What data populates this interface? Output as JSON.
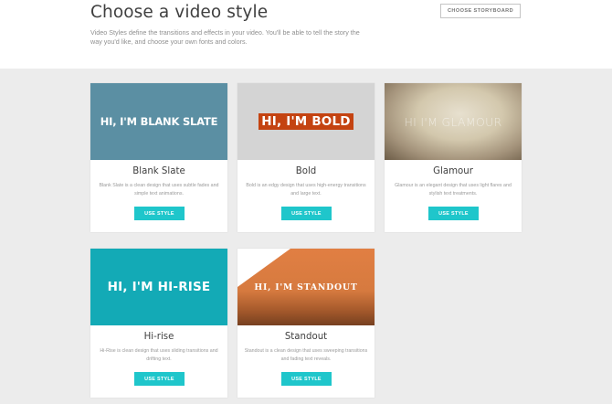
{
  "header": {
    "title": "Choose a video style",
    "subtitle": "Video Styles define the transitions and effects in your video. You'll be able to tell the story the way you'd like, and choose your own fonts and colors.",
    "storyboard_button": "CHOOSE STORYBOARD"
  },
  "styles": [
    {
      "name": "Blank Slate",
      "thumb_text": "HI, I'M BLANK SLATE",
      "description": "Blank Slate is a clean design that uses subtle fades and simple text animations.",
      "button": "USE STYLE",
      "color": "#5b8fa3"
    },
    {
      "name": "Bold",
      "thumb_text": "HI, I'M BOLD",
      "description": "Bold is an edgy design that uses high-energy transitions and large text.",
      "button": "USE STYLE",
      "color": "#c44311"
    },
    {
      "name": "Glamour",
      "thumb_text": "HI I'M GLAMOUR",
      "description": "Glamour is an elegant design that uses light flares and stylish text treatments.",
      "button": "USE STYLE",
      "color": "#d3c8ad"
    },
    {
      "name": "Hi-rise",
      "thumb_text": "HI, I'M HI-RISE",
      "description": "Hi-Rise is clean design that uses sliding transitions and drifting text.",
      "button": "USE STYLE",
      "color": "#13aab6"
    },
    {
      "name": "Standout",
      "thumb_text": "HI, I'M STANDOUT",
      "description": "Standout is a clean design that uses sweeping transitions and fading text reveals.",
      "button": "USE STYLE",
      "color": "#e17f43"
    }
  ],
  "accent_color": "#1fc6cb"
}
